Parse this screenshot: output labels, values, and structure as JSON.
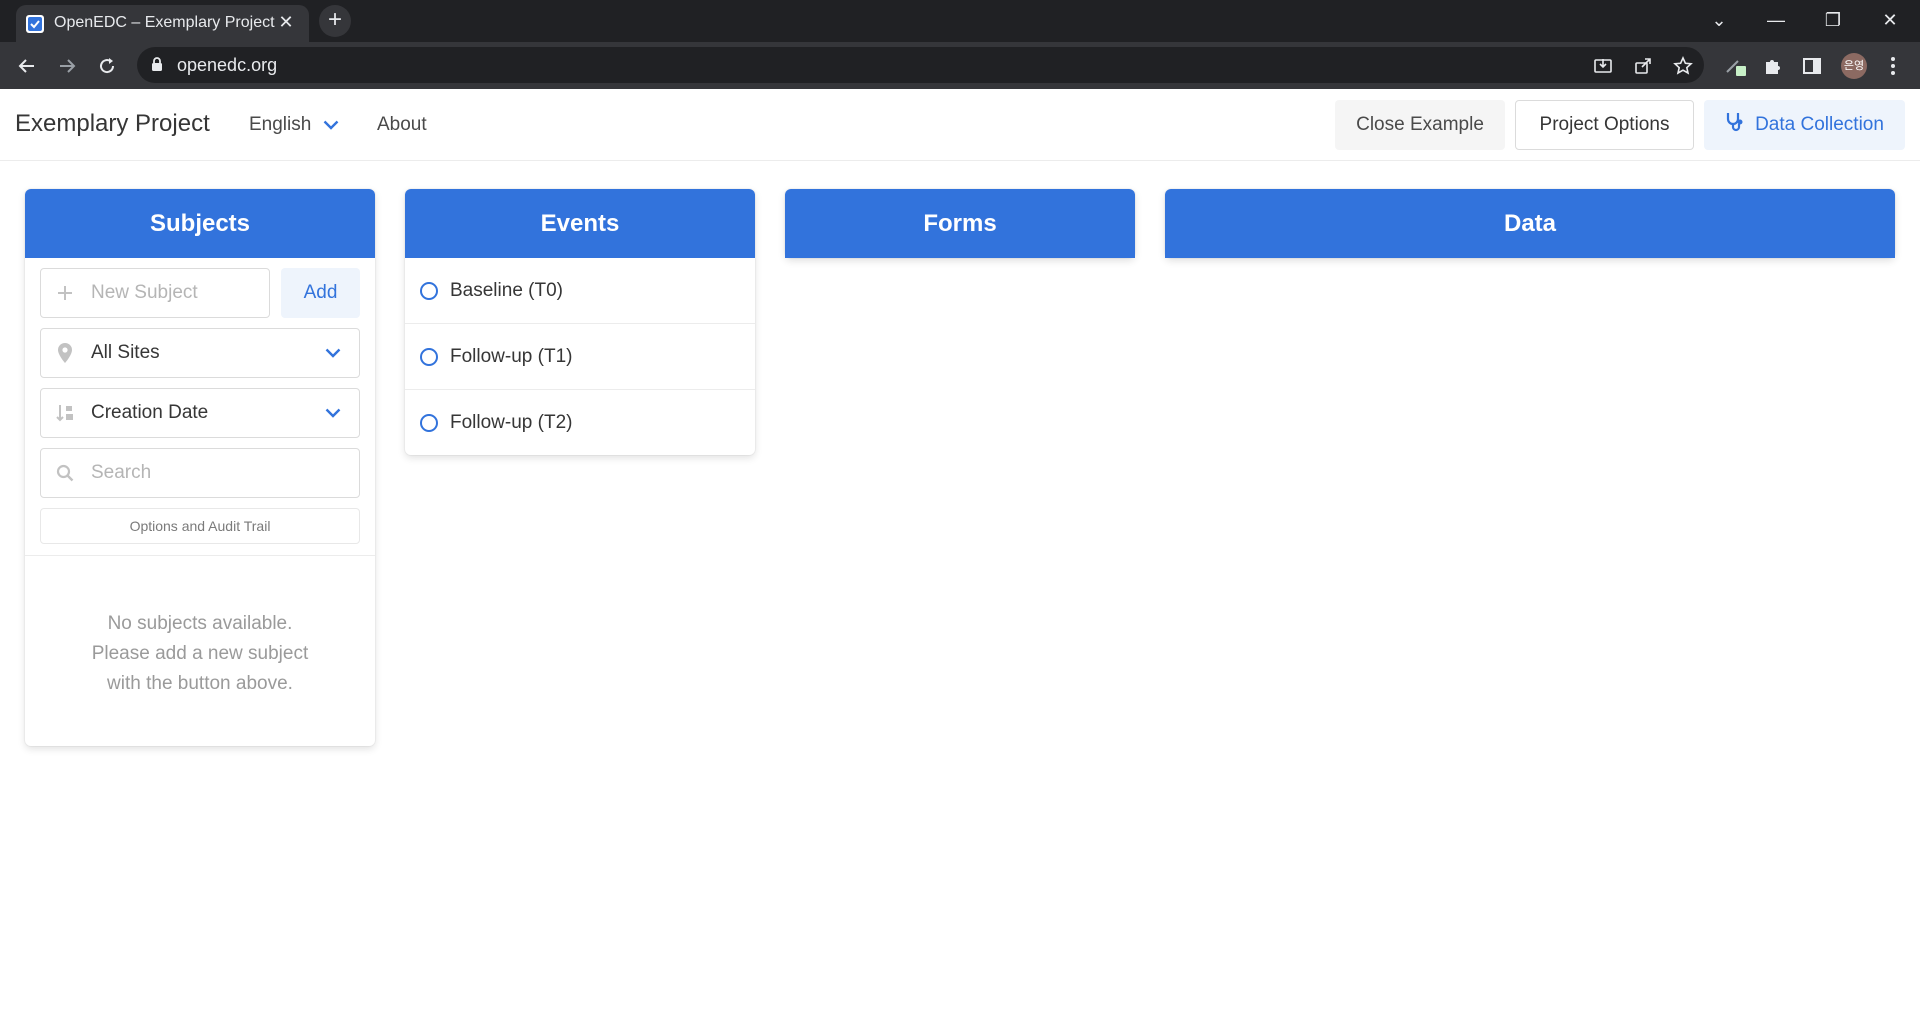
{
  "browser": {
    "tab_title": "OpenEDC – Exemplary Project",
    "url": "openedc.org",
    "profile_initials": "은영"
  },
  "header": {
    "project_title": "Exemplary Project",
    "language": "English",
    "about": "About",
    "close_example": "Close Example",
    "project_options": "Project Options",
    "data_collection": "Data Collection"
  },
  "columns": {
    "subjects": "Subjects",
    "events": "Events",
    "forms": "Forms",
    "data": "Data"
  },
  "subjects": {
    "new_subject_placeholder": "New Subject",
    "add_label": "Add",
    "site_filter": "All Sites",
    "sort_by": "Creation Date",
    "search_placeholder": "Search",
    "options_audit": "Options and Audit Trail",
    "empty_line1": "No subjects available.",
    "empty_line2": "Please add a new subject",
    "empty_line3": "with the button above."
  },
  "events": [
    {
      "label": "Baseline (T0)"
    },
    {
      "label": "Follow-up (T1)"
    },
    {
      "label": "Follow-up (T2)"
    }
  ],
  "colors": {
    "accent": "#3273dc",
    "light_accent": "#eef4fc"
  }
}
